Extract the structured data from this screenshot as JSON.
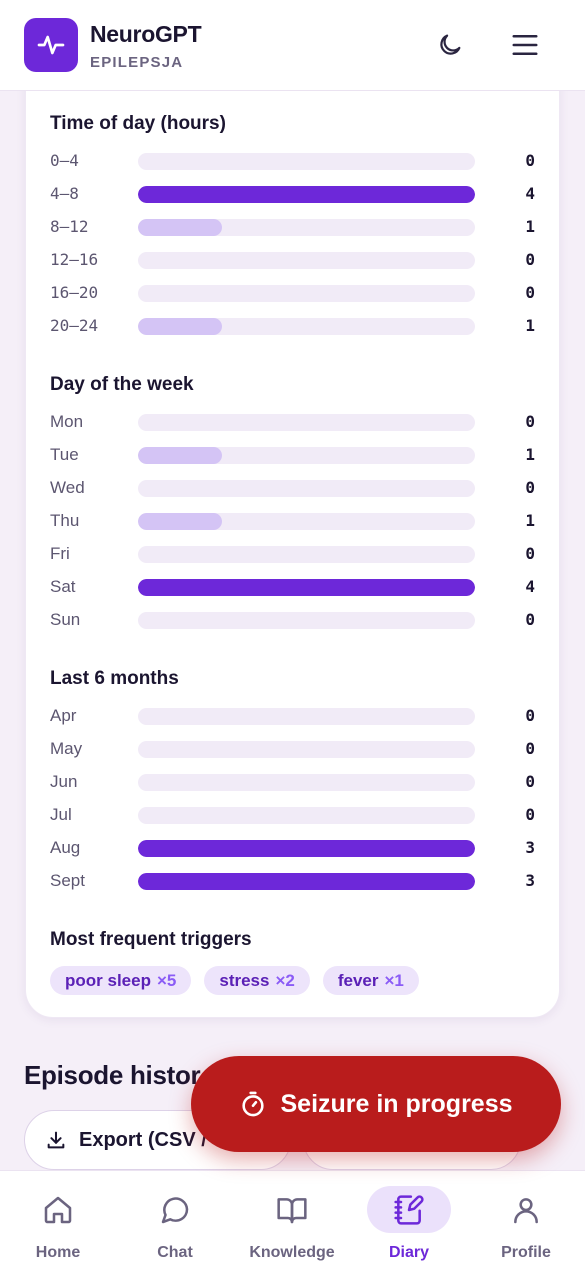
{
  "header": {
    "title": "NeuroGPT",
    "subtitle": "EPILEPSJA",
    "logo_icon": "activity-pulse-icon",
    "theme_icon": "moon-icon",
    "menu_icon": "hamburger-menu-icon"
  },
  "stats": {
    "time_of_day": {
      "title": "Time of day (hours)",
      "max": 4,
      "rows": [
        {
          "label": "0–4",
          "count": "0",
          "value": 0
        },
        {
          "label": "4–8",
          "count": "4",
          "value": 4
        },
        {
          "label": "8–12",
          "count": "1",
          "value": 1
        },
        {
          "label": "12–16",
          "count": "0",
          "value": 0
        },
        {
          "label": "16–20",
          "count": "0",
          "value": 0
        },
        {
          "label": "20–24",
          "count": "1",
          "value": 1
        }
      ]
    },
    "day_of_week": {
      "title": "Day of the week",
      "max": 4,
      "rows": [
        {
          "label": "Mon",
          "count": "0",
          "value": 0
        },
        {
          "label": "Tue",
          "count": "1",
          "value": 1
        },
        {
          "label": "Wed",
          "count": "0",
          "value": 0
        },
        {
          "label": "Thu",
          "count": "1",
          "value": 1
        },
        {
          "label": "Fri",
          "count": "0",
          "value": 0
        },
        {
          "label": "Sat",
          "count": "4",
          "value": 4
        },
        {
          "label": "Sun",
          "count": "0",
          "value": 0
        }
      ]
    },
    "last_months": {
      "title": "Last 6 months",
      "max": 3,
      "rows": [
        {
          "label": "Apr",
          "count": "0",
          "value": 0
        },
        {
          "label": "May",
          "count": "0",
          "value": 0
        },
        {
          "label": "Jun",
          "count": "0",
          "value": 0
        },
        {
          "label": "Jul",
          "count": "0",
          "value": 0
        },
        {
          "label": "Aug",
          "count": "3",
          "value": 3
        },
        {
          "label": "Sept",
          "count": "3",
          "value": 3
        }
      ]
    },
    "triggers": {
      "title": "Most frequent triggers",
      "items": [
        {
          "name": "poor sleep",
          "mult": "×5"
        },
        {
          "name": "stress",
          "mult": "×2"
        },
        {
          "name": "fever",
          "mult": "×1"
        }
      ]
    }
  },
  "episodes": {
    "title": "Episode histor",
    "export_label": "Export (CSV /",
    "export_icon": "download-icon"
  },
  "fab": {
    "label": "Seizure in progress",
    "icon": "stopwatch-icon"
  },
  "nav": [
    {
      "label": "Home",
      "icon": "home-icon",
      "active": false
    },
    {
      "label": "Chat",
      "icon": "chat-bubble-icon",
      "active": false
    },
    {
      "label": "Knowledge",
      "icon": "book-open-icon",
      "active": false
    },
    {
      "label": "Diary",
      "icon": "notebook-pen-icon",
      "active": true
    },
    {
      "label": "Profile",
      "icon": "user-icon",
      "active": false
    }
  ],
  "colors": {
    "accent": "#6d28d9",
    "bar_full": "#6d28d9",
    "bar_low": "#d4c4f5",
    "track": "#f1ebf7",
    "danger": "#b91c1c"
  }
}
